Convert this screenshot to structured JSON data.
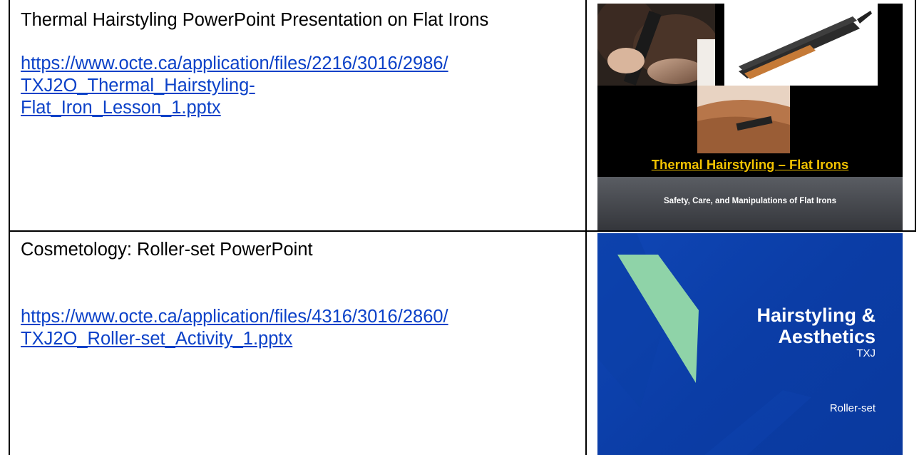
{
  "rows": [
    {
      "title": "Thermal Hairstyling PowerPoint Presentation on Flat Irons",
      "url": "https://www.octe.ca/application/files/2216/3016/2986/TXJ2O_Thermal_Hairstyling-Flat_Iron_Lesson_1.pptx",
      "url_lines": [
        "https://www.octe.ca/application/files/2216/3016/2986/",
        "TXJ2O_Thermal_Hairstyling-",
        "Flat_Iron_Lesson_1.pptx"
      ],
      "thumbnail": {
        "title": "Thermal Hairstyling – Flat Irons",
        "subtitle": "Safety, Care, and Manipulations of Flat Irons",
        "title_color": "#f2c200",
        "background": "#000000"
      }
    },
    {
      "title": "Cosmetology: Roller-set PowerPoint",
      "url": "https://www.octe.ca/application/files/4316/3016/2860/TXJ2O_Roller-set_Activity_1.pptx",
      "url_lines": [
        "https://www.octe.ca/application/files/4316/3016/2860/",
        "TXJ2O_Roller-set_Activity_1.pptx"
      ],
      "thumbnail": {
        "heading_line1": "Hairstyling &",
        "heading_line2": "Aesthetics",
        "course": "TXJ",
        "topic": "Roller-set",
        "background": "#0f46b5",
        "accent": "#8fd3a8"
      }
    }
  ],
  "colors": {
    "link": "#0b41c8",
    "border": "#000000"
  }
}
